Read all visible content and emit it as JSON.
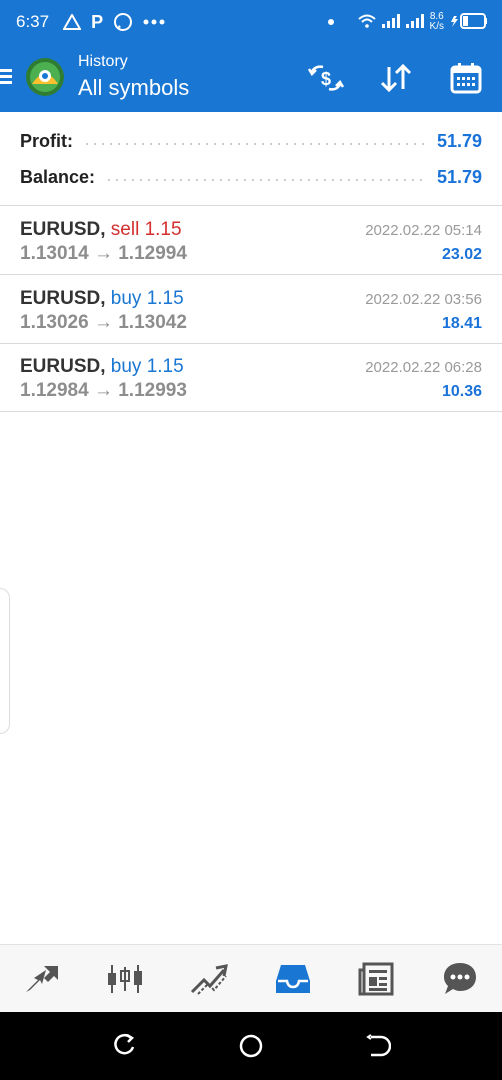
{
  "status_bar": {
    "time": "6:37",
    "left_icons": [
      "warning-triangle-icon",
      "p-parking-icon",
      "whatsapp-icon",
      "more-dots-icon"
    ],
    "net_speed_value": "8.6",
    "net_speed_unit": "K/s"
  },
  "app_bar": {
    "subtitle": "History",
    "title": "All symbols",
    "actions": [
      "currency-exchange-icon",
      "sort-icon",
      "calendar-icon"
    ]
  },
  "summary": {
    "profit_label": "Profit:",
    "profit_value": "51.79",
    "balance_label": "Balance:",
    "balance_value": "51.79"
  },
  "deals": [
    {
      "symbol": "EURUSD,",
      "type": "sell 1.15",
      "prices": "1.13014 → 1.12994",
      "time": "2022.02.22 05:14",
      "profit": "23.02"
    },
    {
      "symbol": "EURUSD,",
      "type": "buy 1.15",
      "prices": "1.13026 → 1.13042",
      "time": "2022.02.22 03:56",
      "profit": "18.41"
    },
    {
      "symbol": "EURUSD,",
      "type": "buy 1.15",
      "prices": "1.12984 → 1.12993",
      "time": "2022.02.22 06:28",
      "profit": "10.36"
    }
  ],
  "tabs": [
    "quotes-icon",
    "chart-icon",
    "trade-icon",
    "history-icon",
    "news-icon",
    "messages-icon"
  ],
  "active_tab": "history-icon",
  "colors": {
    "primary": "#1976d2",
    "sell": "#d32f2f",
    "buy": "#1976d2",
    "value": "#1a73d9"
  }
}
